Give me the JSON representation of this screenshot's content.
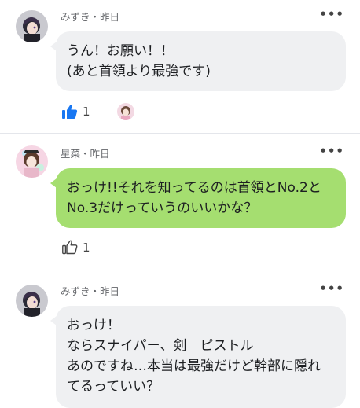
{
  "posts": [
    {
      "author": "みずき",
      "time": "昨日",
      "header": "みずき・昨日",
      "lines": [
        "うん！お願い！！",
        "(あと首領より最強です)"
      ],
      "like_count": "1",
      "liked": true
    },
    {
      "author": "星菜",
      "time": "昨日",
      "header": "星菜・昨日",
      "lines": [
        "おっけ!!それを知ってるのは首領とNo.2と",
        "No.3だけっていうのいいかな？"
      ],
      "like_count": "1",
      "liked": false
    },
    {
      "author": "みずき",
      "time": "昨日",
      "header": "みずき・昨日",
      "lines": [
        "おっけ！",
        "ならスナイパー、剣　ピストル",
        "あのですね…本当は最強だけど幹部に隠れ",
        "てるっていい？"
      ]
    }
  ],
  "more_icon": "•••",
  "colors": {
    "bubble_gray": "#eff0f2",
    "bubble_green": "#a5de70",
    "like_blue": "#1877f2"
  }
}
